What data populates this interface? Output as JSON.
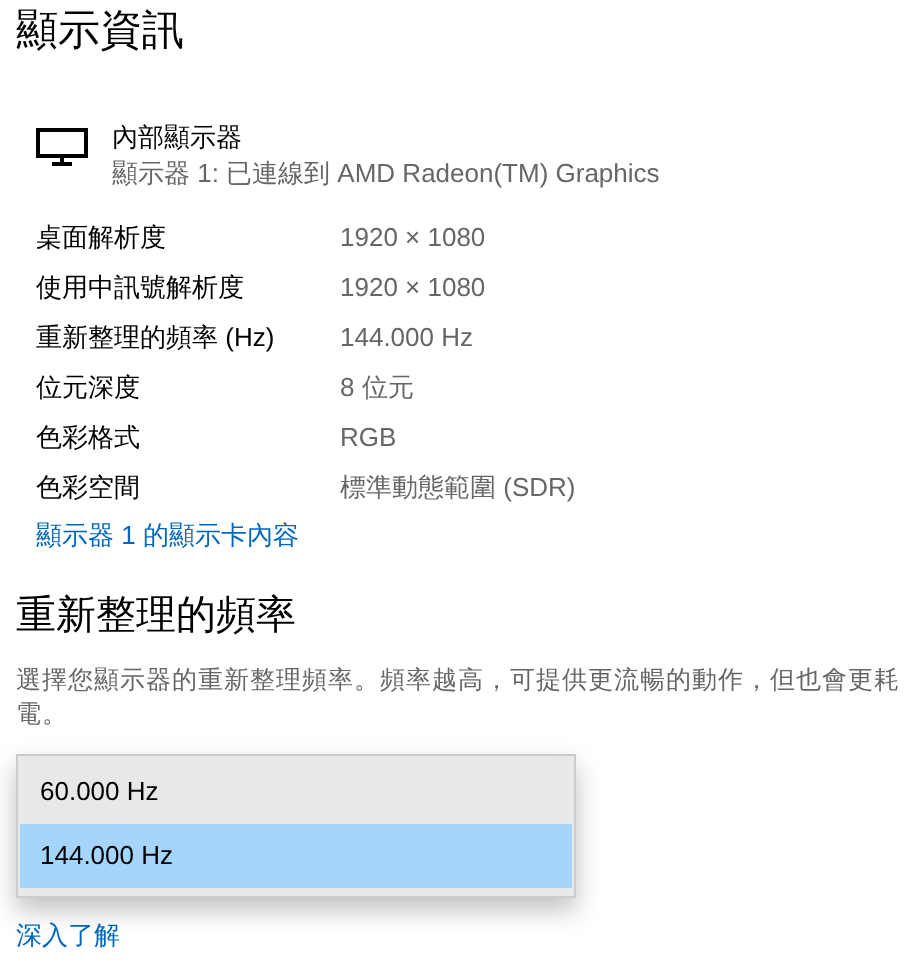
{
  "title": "顯示資訊",
  "display": {
    "name": "內部顯示器",
    "detail": "顯示器 1: 已連線到 AMD Radeon(TM) Graphics"
  },
  "properties": [
    {
      "label": "桌面解析度",
      "value": "1920 × 1080"
    },
    {
      "label": "使用中訊號解析度",
      "value": "1920 × 1080"
    },
    {
      "label": "重新整理的頻率 (Hz)",
      "value": "144.000 Hz"
    },
    {
      "label": "位元深度",
      "value": "8 位元"
    },
    {
      "label": "色彩格式",
      "value": "RGB"
    },
    {
      "label": "色彩空間",
      "value": "標準動態範圍 (SDR)"
    }
  ],
  "adapter_link": "顯示器 1 的顯示卡內容",
  "refresh_section": {
    "heading": "重新整理的頻率",
    "description": "選擇您顯示器的重新整理頻率。頻率越高，可提供更流暢的動作，但也會更耗電。",
    "options": [
      {
        "label": "60.000 Hz",
        "selected": false
      },
      {
        "label": "144.000 Hz",
        "selected": true
      }
    ],
    "learn_more": "深入了解"
  }
}
